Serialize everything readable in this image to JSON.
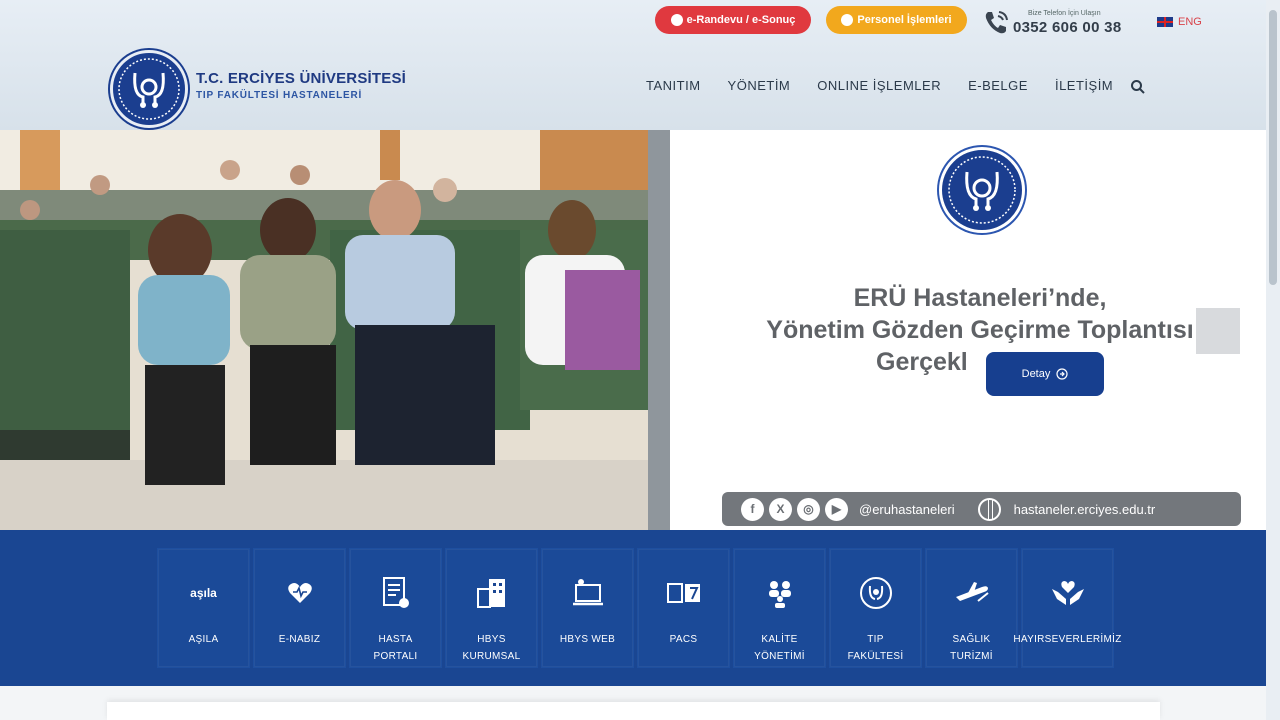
{
  "topbar": {
    "appointment_label": "e-Randevu / e-Sonuç",
    "staff_label": "Personel İşlemleri",
    "phone_caption": "Bize Telefon İçin Ulaşın",
    "phone_number": "0352 606 00 38",
    "language_label": "ENG"
  },
  "brand": {
    "title": "T.C. ERCİYES ÜNİVERSİTESİ",
    "subtitle": "TIP FAKÜLTESİ HASTANELERİ"
  },
  "nav": {
    "items": [
      "TANITIM",
      "YÖNETİM",
      "ONLINE İŞLEMLER",
      "E-BELGE",
      "İLETİŞİM"
    ]
  },
  "hero": {
    "title_line1": "ERÜ Hastaneleri’nde,",
    "title_line2": "Yönetim Gözden Geçirme Toplantısı",
    "title_line3": "Gerçekl",
    "detail_label": "Detay",
    "social_handle": "@eruhastaneleri",
    "website": "hastaneler.erciyes.edu.tr"
  },
  "quick_links": [
    {
      "label": "AŞILA",
      "icon": "aşıla-icon",
      "icon_text": "aşıla"
    },
    {
      "label": "E-NABIZ",
      "icon": "heart-pulse-icon",
      "icon_text": ""
    },
    {
      "label": "HASTA\nPORTALI",
      "icon": "document-icon",
      "icon_text": ""
    },
    {
      "label": "HBYS\nKURUMSAL",
      "icon": "building-icon",
      "icon_text": ""
    },
    {
      "label": "HBYS WEB",
      "icon": "computer-icon",
      "icon_text": ""
    },
    {
      "label": "PACS",
      "icon": "xray-icon",
      "icon_text": ""
    },
    {
      "label": "KALİTE\nYÖNETİMİ",
      "icon": "team-icon",
      "icon_text": ""
    },
    {
      "label": "TIP\nFAKÜLTESİ",
      "icon": "faculty-icon",
      "icon_text": ""
    },
    {
      "label": "SAĞLIK\nTURİZMİ",
      "icon": "airplane-icon",
      "icon_text": ""
    },
    {
      "label": "HAYIRSEVERLERİMİZ",
      "icon": "hands-heart-icon",
      "icon_text": ""
    }
  ],
  "colors": {
    "brand_blue": "#1a4692",
    "red": "#e0393f",
    "orange": "#f2a81d"
  }
}
